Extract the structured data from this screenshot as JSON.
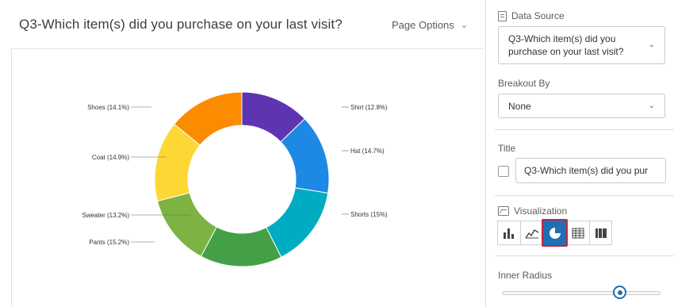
{
  "header": {
    "question_title": "Q3-Which item(s) did you purchase on your last visit?",
    "page_options_label": "Page Options"
  },
  "chart_data": {
    "type": "pie",
    "donut": true,
    "slices": [
      {
        "label": "Shirt (12.8%)",
        "value": 12.8,
        "color": "#5e35b1"
      },
      {
        "label": "Hat (14.7%)",
        "value": 14.7,
        "color": "#1e88e5"
      },
      {
        "label": "Shorts (15%)",
        "value": 15.0,
        "color": "#00acc1"
      },
      {
        "label": "Pants (15.2%)",
        "value": 15.2,
        "color": "#43a047"
      },
      {
        "label": "Sweater (13.2%)",
        "value": 13.2,
        "color": "#7cb342"
      },
      {
        "label": "Coat (14.9%)",
        "value": 14.9,
        "color": "#fdd835"
      },
      {
        "label": "Shoes (14.1%)",
        "value": 14.1,
        "color": "#fb8c00"
      }
    ]
  },
  "sidebar": {
    "data_source": {
      "label": "Data Source",
      "value": "Q3-Which item(s) did you purchase on your last visit?"
    },
    "breakout_by": {
      "label": "Breakout By",
      "value": "None"
    },
    "title": {
      "label": "Title",
      "value": "Q3-Which item(s) did you pur"
    },
    "visualization": {
      "label": "Visualization",
      "options": [
        "bar-chart",
        "line-chart",
        "pie-chart",
        "table",
        "breakdown-bar"
      ],
      "selected": "pie-chart"
    },
    "inner_radius": {
      "label": "Inner Radius",
      "level": 0.74
    }
  },
  "colors": {
    "accent": "#1e6fb3",
    "highlight": "#c0283a"
  }
}
